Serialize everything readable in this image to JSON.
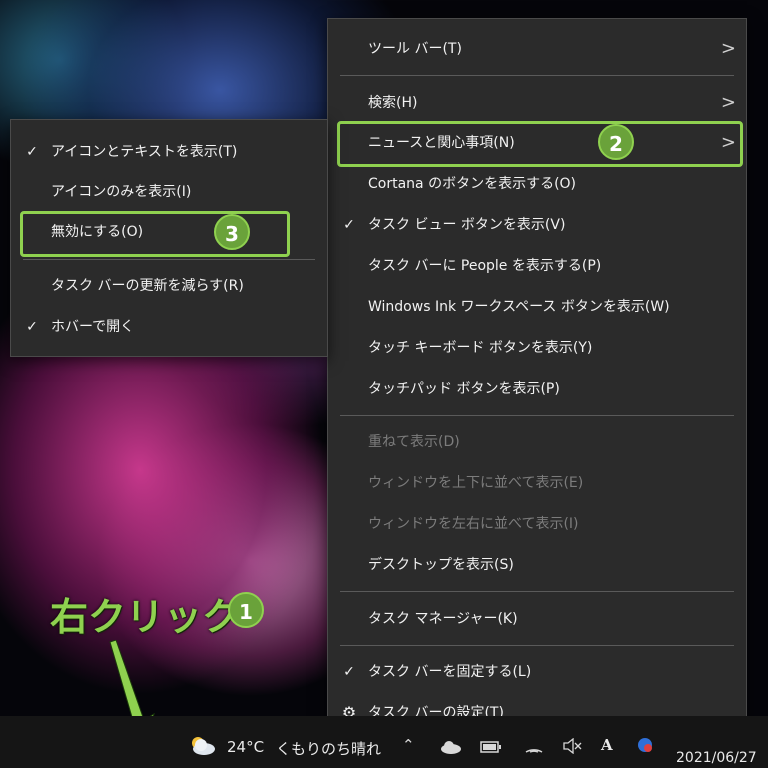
{
  "main_menu": {
    "items": [
      {
        "label": "ツール バー(T)",
        "check": "",
        "arrow": ">",
        "disabled": false
      },
      {
        "label": "検索(H)",
        "check": "",
        "arrow": ">",
        "disabled": false
      },
      {
        "label": "ニュースと関心事項(N)",
        "check": "",
        "arrow": ">",
        "disabled": false
      },
      {
        "label": "Cortana のボタンを表示する(O)",
        "check": "",
        "arrow": "",
        "disabled": false
      },
      {
        "label": "タスク ビュー ボタンを表示(V)",
        "check": "✓",
        "arrow": "",
        "disabled": false
      },
      {
        "label": "タスク バーに People を表示する(P)",
        "check": "",
        "arrow": "",
        "disabled": false
      },
      {
        "label": "Windows Ink ワークスペース ボタンを表示(W)",
        "check": "",
        "arrow": "",
        "disabled": false
      },
      {
        "label": "タッチ キーボード ボタンを表示(Y)",
        "check": "",
        "arrow": "",
        "disabled": false
      },
      {
        "label": "タッチパッド ボタンを表示(P)",
        "check": "",
        "arrow": "",
        "disabled": false
      },
      {
        "label": "重ねて表示(D)",
        "check": "",
        "arrow": "",
        "disabled": true
      },
      {
        "label": "ウィンドウを上下に並べて表示(E)",
        "check": "",
        "arrow": "",
        "disabled": true
      },
      {
        "label": "ウィンドウを左右に並べて表示(I)",
        "check": "",
        "arrow": "",
        "disabled": true
      },
      {
        "label": "デスクトップを表示(S)",
        "check": "",
        "arrow": "",
        "disabled": false
      },
      {
        "label": "タスク マネージャー(K)",
        "check": "",
        "arrow": "",
        "disabled": false
      },
      {
        "label": "タスク バーを固定する(L)",
        "check": "✓",
        "arrow": "",
        "disabled": false
      },
      {
        "label": "タスク バーの設定(T)",
        "check": "⚙",
        "arrow": "",
        "disabled": false
      }
    ]
  },
  "sub_menu": {
    "items": [
      {
        "label": "アイコンとテキストを表示(T)",
        "check": "✓"
      },
      {
        "label": "アイコンのみを表示(I)",
        "check": ""
      },
      {
        "label": "無効にする(O)",
        "check": ""
      },
      {
        "label": "タスク バーの更新を減らす(R)",
        "check": ""
      },
      {
        "label": "ホバーで開く",
        "check": "✓"
      }
    ]
  },
  "annotations": {
    "right_click": "右クリック",
    "step1": "1",
    "step2": "2",
    "step3": "3",
    "accent_color": "#8fd14f"
  },
  "taskbar": {
    "weather_temp": "24°C",
    "weather_text": "くもりのち晴れ",
    "ime_label": "A",
    "date": "2021/06/27"
  }
}
